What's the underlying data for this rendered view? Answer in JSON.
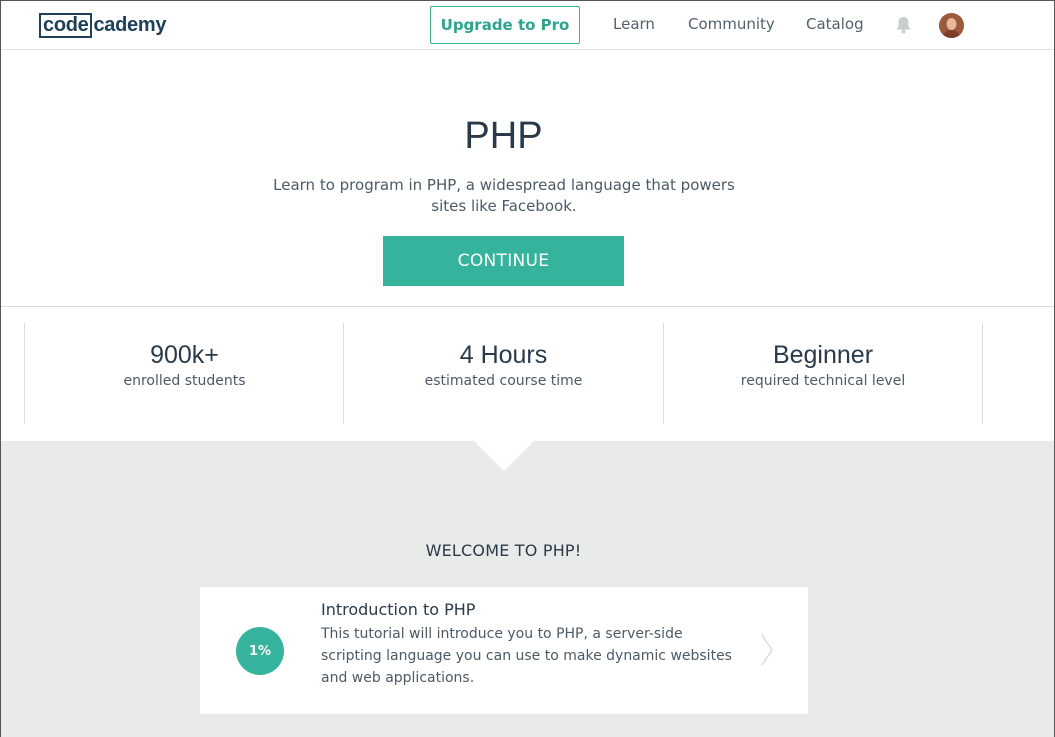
{
  "header": {
    "logo": {
      "boxed": "code",
      "rest": "cademy"
    },
    "upgrade_label": "Upgrade to Pro",
    "nav": [
      "Learn",
      "Community",
      "Catalog"
    ],
    "icons": {
      "notifications": "bell-icon",
      "profile": "avatar"
    }
  },
  "hero": {
    "title": "PHP",
    "description": "Learn to program in PHP, a widespread language that powers sites like Facebook.",
    "cta_label": "CONTINUE"
  },
  "stats": [
    {
      "value": "900k+",
      "label": "enrolled students"
    },
    {
      "value": "4 Hours",
      "label": "estimated course time"
    },
    {
      "value": "Beginner",
      "label": "required technical level"
    }
  ],
  "section": {
    "heading": "WELCOME TO PHP!",
    "lessons": [
      {
        "progress": "1%",
        "title": "Introduction to PHP",
        "description": "This tutorial will introduce you to PHP, a server-side scripting language you can use to make dynamic websites and web applications."
      }
    ]
  },
  "colors": {
    "accent": "#36b39d",
    "text_dark": "#2b3a48",
    "section_bg": "#e9eaea"
  }
}
